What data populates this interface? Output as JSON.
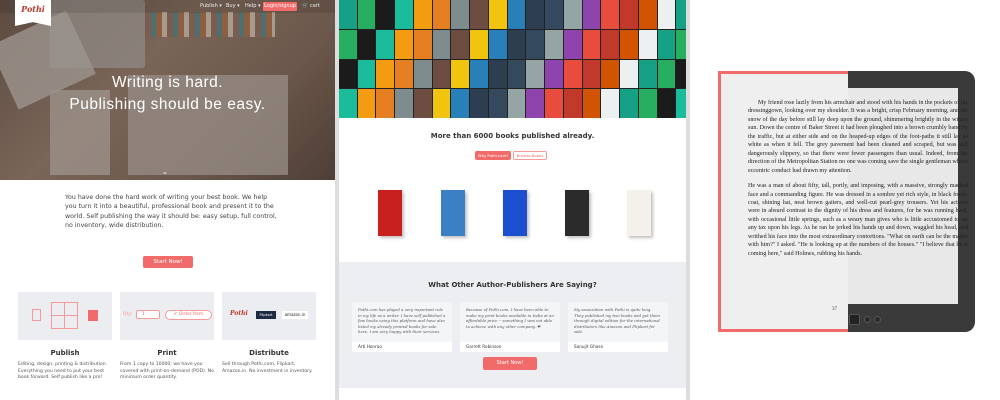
{
  "colors": {
    "accent": "#f26b6b",
    "light_gray": "#ebedf0",
    "reader": "#3a3a3a"
  },
  "panel1": {
    "logo": "Pothi",
    "nav": {
      "publish": "Publish ▾",
      "buy": "Buy ▾",
      "help": "Help ▾",
      "login": "Login/signup",
      "cart": "cart",
      "cart_icon": "cart-icon"
    },
    "hero": {
      "line1": "Writing is hard.",
      "line2": "Publishing should be easy.",
      "chevron": "⌄"
    },
    "intro": "You have done the hard work of writing your best book. We help you turn it into a beautiful, professional book and present it to the world. Self publishing the way it should be: easy setup, full control, no inventory, wide distribution.",
    "start_button": "Start Now!",
    "print_widget": {
      "qty_label": "Qty:",
      "qty_value": "1",
      "order_button": "✔ Order Item"
    },
    "distribute_logos": [
      "Pothi",
      "Flipkart",
      "amazon.in"
    ],
    "features": [
      {
        "title": "Publish",
        "desc": "Editing, design, printing & distribution. Everything you need to put your best book forward. Self publish like a pro!"
      },
      {
        "title": "Print",
        "desc": "From 1 copy to 10000; we have you covered with print-on-demand (POD). No minimum order quantity."
      },
      {
        "title": "Distribute",
        "desc": "Sell through Pothi.com, Flipkart, Amazon.in. No investment in inventory."
      }
    ]
  },
  "panel2": {
    "headline": "More than 6000 books published already.",
    "buttons": {
      "why": "Why Pothi.com?",
      "browse": "Browse Books"
    },
    "featured_book_colors": [
      "#c8201e",
      "#3b7fc4",
      "#1c4fd0",
      "#2b2b2b",
      "#f3f1ea"
    ],
    "testimonials_title": "What Other Author-Publishers Are Saying?",
    "testimonials": [
      {
        "quote": "Pothi.com has played a very important role in my life as a writer. I have self published a few books using this platform and have also listed my already printed books for sale here. I am very happy with their services.",
        "name": "Arti Honrao"
      },
      {
        "quote": "Because of Pothi.com, I have been able to make my print books available in India at an affordable price -- something I was not able to achieve with any other company. ❤",
        "name": "Garrett Robinson"
      },
      {
        "quote": "My association with Pothi is quite long. They published my two books and got them through digital edition for the international distributors like Amazon and Flipkart for sale.",
        "name": "Sanujit Ghose"
      }
    ],
    "start_button": "Start Now!"
  },
  "panel3": {
    "paragraphs": [
      "My friend rose lazily from his armchair and stood with his hands in the pockets of his dressinggown, looking over my shoulder. It was a bright, crisp February morning, and the snow of the day before still lay deep upon the ground, shimmering brightly in the wintry sun. Down the centre of Baker Street it had been ploughed into a brown crumbly band by the traffic, but at either side and on the heaped-up edges of the foot-paths it still lay as white as when it fell. The grey pavement had been cleaned and scraped, but was still dangerously slippery, so that there were fewer passengers than usual. Indeed, from the direction of the Metropolitan Station no one was coming save the single gentleman whose eccentric conduct had drawn my attention.",
      "He was a man of about fifty, tall, portly, and imposing, with a massive, strongly marked face and a commanding figure. He was dressed in a sombre yet rich style, in black frock-coat, shining hat, neat brown gaiters, and well-cut pearl-grey trousers. Yet his actions were in absurd contrast to the dignity of his dress and features, for he was running hard, with occasional little springs, such as a weary man gives who is little accustomed to set any tax upon his legs. As he ran he jerked his hands up and down, waggled his head, and writhed his face into the most extraordinary contortions. \"What on earth can be the matter with him?\" I asked. \"He is looking up at the numbers of the houses.\" \"I believe that he is coming here,\" said Holmes, rubbing his hands."
    ],
    "page_number": "37"
  }
}
